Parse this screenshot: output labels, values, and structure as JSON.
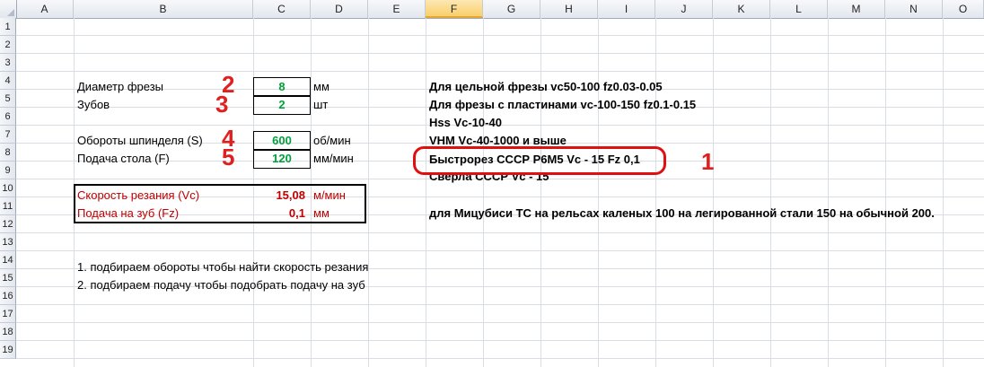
{
  "columns": [
    "A",
    "B",
    "C",
    "D",
    "E",
    "F",
    "G",
    "H",
    "I",
    "J",
    "K",
    "L",
    "M",
    "N",
    "O"
  ],
  "selected_column": "F",
  "rows": [
    "1",
    "2",
    "3",
    "4",
    "5",
    "6",
    "7",
    "8",
    "9",
    "10",
    "11",
    "12",
    "13",
    "14",
    "15",
    "16",
    "17",
    "18",
    "19"
  ],
  "inputs": {
    "diameter_label": "Диаметр фрезы",
    "diameter_value": "8",
    "diameter_unit": "мм",
    "teeth_label": "Зубов",
    "teeth_value": "2",
    "teeth_unit": "шт",
    "spindle_label": "Обороты шпинделя (S)",
    "spindle_value": "600",
    "spindle_unit": "об/мин",
    "feed_label": "Подача стола (F)",
    "feed_value": "120",
    "feed_unit": "мм/мин"
  },
  "results": {
    "speed_label": "Скорость резания (Vc)",
    "speed_value": "15,08",
    "speed_unit": "м/мин",
    "fz_label": "Подача на зуб (Fz)",
    "fz_value": "0,1",
    "fz_unit": "мм"
  },
  "notes": {
    "n4": "Для цельной фрезы vc50-100 fz0.03-0.05",
    "n5": "Для фрезы с пластинами vc-100-150 fz0.1-0.15",
    "n6": "Hss  Vc-10-40",
    "n7": "VHM Vc-40-1000 и выше",
    "n8": "Быстрорез СССР Р6М5 Vc - 15 Fz 0,1",
    "n9": "Сверла СССР Vc - 15",
    "n11": "для Мицубиси ТС на рельсах каленых 100 на легированной стали 150 на обычной 200."
  },
  "instructions": {
    "i14": "1. подбираем обороты чтобы найти скорость резания",
    "i15": "2. подбираем подачу чтобы подобрать подачу на зуб"
  },
  "annotations": {
    "a1": "1",
    "a2": "2",
    "a3": "3",
    "a4": "4",
    "a5": "5"
  },
  "colors": {
    "accent_red": "#e02020",
    "input_green": "#00a03a",
    "result_red": "#c00000"
  }
}
